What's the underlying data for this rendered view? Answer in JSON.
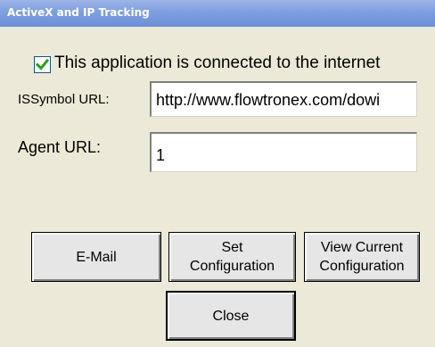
{
  "window": {
    "title": "ActiveX and IP Tracking"
  },
  "options": {
    "internet_checkbox": {
      "label": "This application is connected to the internet",
      "checked": true,
      "check_color": "#21a121"
    }
  },
  "fields": {
    "issymbol_url": {
      "label": "ISSymbol URL:",
      "value": "http://www.flowtronex.com/dowi"
    },
    "agent_url": {
      "label": "Agent URL:",
      "value": "1"
    }
  },
  "buttons": {
    "email": "E-Mail",
    "set_configuration": "Set\nConfiguration",
    "view_configuration": "View Current\nConfiguration",
    "close": "Close"
  },
  "colors": {
    "window_background": "#ece9d8",
    "titlebar": "#7e9fdf",
    "button_face": "#e6e6e6"
  }
}
